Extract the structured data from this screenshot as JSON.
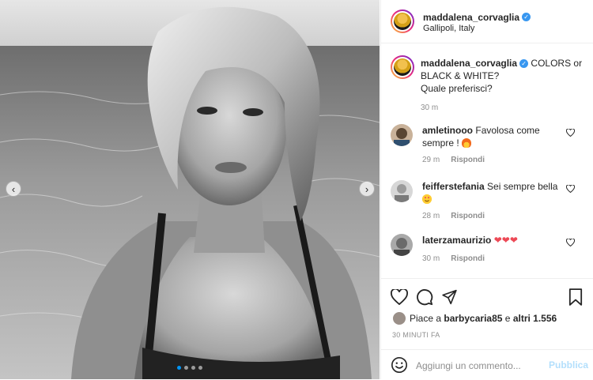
{
  "post": {
    "carousel_total": 4,
    "carousel_active": 1,
    "prev_arrow": "‹",
    "next_arrow": "›"
  },
  "header": {
    "username": "maddalena_corvaglia",
    "location": "Gallipoli, Italy",
    "verified_icon": "verified-badge-icon"
  },
  "caption": {
    "username": "maddalena_corvaglia",
    "text_line1": "COLORS or BLACK & WHITE?",
    "text_line2": "Quale preferisci?",
    "time": "30 m"
  },
  "comments": [
    {
      "username": "amletinooo",
      "text": "Favolosa come sempre !",
      "emoji": "fire-emoji",
      "time": "29 m",
      "reply_label": "Rispondi"
    },
    {
      "username": "feifferstefania",
      "text": "Sei sempre bella",
      "emoji": "heart-eyes-emoji",
      "time": "28 m",
      "reply_label": "Rispondi"
    },
    {
      "username": "laterzamaurizio",
      "text": "❤❤❤",
      "emoji": "",
      "time": "30 m",
      "reply_label": "Rispondi"
    }
  ],
  "actions": {
    "likes_prefix": "Piace a",
    "liked_by": "barbycaria85",
    "likes_mid": "e",
    "likes_others": "altri 1.556",
    "timestamp": "30 MINUTI FA"
  },
  "add_comment": {
    "placeholder": "Aggiungi un commento...",
    "publish_label": "Pubblica"
  },
  "colors": {
    "accent": "#0095f6",
    "verified": "#3897f0",
    "publish_disabled": "#b3dffc",
    "heart_red": "#ed4956"
  }
}
